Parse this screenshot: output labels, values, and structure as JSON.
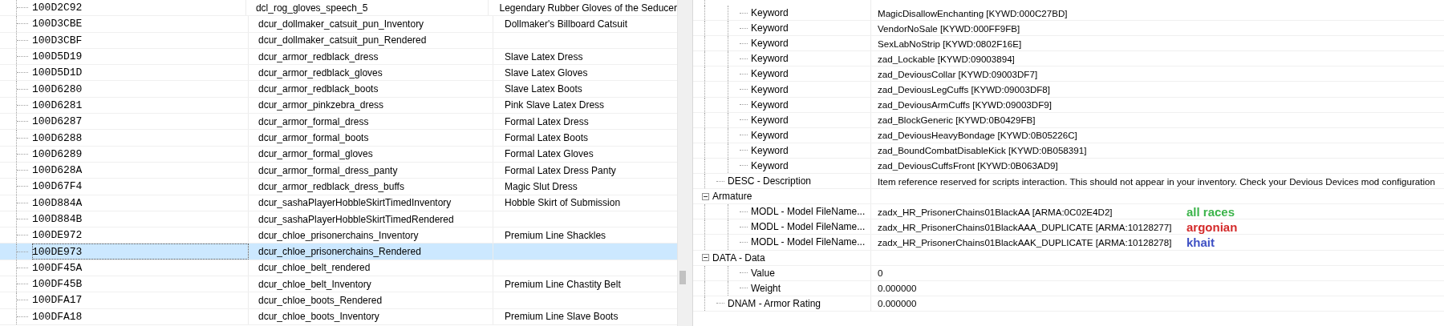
{
  "records": {
    "rows": [
      {
        "form_id": "100D2C92",
        "editor_id": "dcl_rog_gloves_speech_5",
        "name": "Legendary Rubber Gloves of the Seducer",
        "selected": false
      },
      {
        "form_id": "100D3CBE",
        "editor_id": "dcur_dollmaker_catsuit_pun_Inventory",
        "name": "Dollmaker's Billboard Catsuit",
        "selected": false
      },
      {
        "form_id": "100D3CBF",
        "editor_id": "dcur_dollmaker_catsuit_pun_Rendered",
        "selected": false
      },
      {
        "form_id": "100D5D19",
        "editor_id": "dcur_armor_redblack_dress",
        "name": "Slave Latex Dress",
        "selected": false
      },
      {
        "form_id": "100D5D1D",
        "editor_id": "dcur_armor_redblack_gloves",
        "name": "Slave Latex Gloves",
        "selected": false
      },
      {
        "form_id": "100D6280",
        "editor_id": "dcur_armor_redblack_boots",
        "name": "Slave Latex Boots",
        "selected": false
      },
      {
        "form_id": "100D6281",
        "editor_id": "dcur_armor_pinkzebra_dress",
        "name": "Pink Slave Latex Dress",
        "selected": false
      },
      {
        "form_id": "100D6287",
        "editor_id": "dcur_armor_formal_dress",
        "name": "Formal Latex Dress",
        "selected": false
      },
      {
        "form_id": "100D6288",
        "editor_id": "dcur_armor_formal_boots",
        "name": "Formal Latex Boots",
        "selected": false
      },
      {
        "form_id": "100D6289",
        "editor_id": "dcur_armor_formal_gloves",
        "name": "Formal Latex Gloves",
        "selected": false
      },
      {
        "form_id": "100D628A",
        "editor_id": "dcur_armor_formal_dress_panty",
        "name": "Formal Latex Dress Panty",
        "selected": false
      },
      {
        "form_id": "100D67F4",
        "editor_id": "dcur_armor_redblack_dress_buffs",
        "name": "Magic Slut Dress",
        "selected": false
      },
      {
        "form_id": "100D884A",
        "editor_id": "dcur_sashaPlayerHobbleSkirtTimedInventory",
        "name": "Hobble Skirt of Submission",
        "selected": false
      },
      {
        "form_id": "100D884B",
        "editor_id": "dcur_sashaPlayerHobbleSkirtTimedRendered",
        "selected": false
      },
      {
        "form_id": "100DE972",
        "editor_id": "dcur_chloe_prisonerchains_Inventory",
        "name": "Premium Line Shackles",
        "selected": false
      },
      {
        "form_id": "100DE973",
        "editor_id": "dcur_chloe_prisonerchains_Rendered",
        "selected": true
      },
      {
        "form_id": "100DF45A",
        "editor_id": "dcur_chloe_belt_rendered",
        "selected": false
      },
      {
        "form_id": "100DF45B",
        "editor_id": "dcur_chloe_belt_Inventory",
        "name": "Premium Line Chastity Belt",
        "selected": false
      },
      {
        "form_id": "100DFA17",
        "editor_id": "dcur_chloe_boots_Rendered",
        "selected": false
      },
      {
        "form_id": "100DFA18",
        "editor_id": "dcur_chloe_boots_Inventory",
        "name": "Premium Line Slave Boots",
        "selected": false
      }
    ]
  },
  "details": {
    "rows": [
      {
        "children": [
          {
            "label": "Keyword",
            "value": "MagicDisallowEnchanting [KYWD:000C27BD]"
          },
          {
            "label": "Keyword",
            "value": "VendorNoSale [KYWD:000FF9FB]"
          },
          {
            "label": "Keyword",
            "value": "SexLabNoStrip [KYWD:0802F16E]"
          },
          {
            "label": "Keyword",
            "value": "zad_Lockable [KYWD:09003894]"
          },
          {
            "label": "Keyword",
            "value": "zad_DeviousCollar [KYWD:09003DF7]"
          },
          {
            "label": "Keyword",
            "value": "zad_DeviousLegCuffs [KYWD:09003DF8]"
          },
          {
            "label": "Keyword",
            "value": "zad_DeviousArmCuffs [KYWD:09003DF9]"
          },
          {
            "label": "Keyword",
            "value": "zad_BlockGeneric [KYWD:0B0429FB]"
          },
          {
            "label": "Keyword",
            "value": "zad_DeviousHeavyBondage [KYWD:0B05226C]"
          },
          {
            "label": "Keyword",
            "value": "zad_BoundCombatDisableKick [KYWD:0B058391]"
          },
          {
            "label": "Keyword",
            "value": "zad_DeviousCuffsFront [KYWD:0B063AD9]"
          }
        ]
      },
      {
        "label": "DESC - Description",
        "value": "Item reference reserved for scripts interaction. This should not appear in your inventory. Check your Devious Devices mod configuration"
      },
      {
        "label": "Armature",
        "expanded": true,
        "children": [
          {
            "label": "MODL - Model FileName...",
            "value": "zadx_HR_PrisonerChains01BlackAA [ARMA:0C02E4D2]",
            "note": {
              "text": "all races",
              "color": "#3cb44b"
            }
          },
          {
            "label": "MODL - Model FileName...",
            "value": "zadx_HR_PrisonerChains01BlackAAA_DUPLICATE [ARMA:10128277]",
            "note": {
              "text": "argonian",
              "color": "#d42a2a"
            }
          },
          {
            "label": "MODL - Model FileName...",
            "value": "zadx_HR_PrisonerChains01BlackAAK_DUPLICATE [ARMA:10128278]",
            "note": {
              "text": "khait",
              "color": "#3f51c4"
            }
          }
        ]
      },
      {
        "label": "DATA - Data",
        "expanded": true,
        "children": [
          {
            "label": "Value",
            "value": "0"
          },
          {
            "label": "Weight",
            "value": "0.000000"
          }
        ]
      },
      {
        "label": "DNAM - Armor Rating",
        "value": "0.000000"
      }
    ]
  }
}
